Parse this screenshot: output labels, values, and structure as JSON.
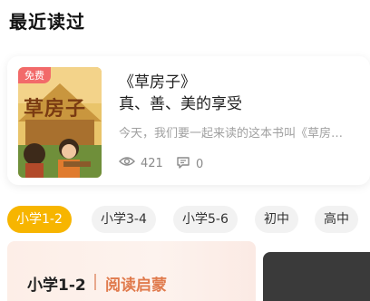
{
  "section": {
    "title": "最近读过"
  },
  "recent_book": {
    "badge": "免费",
    "cover_title": "草房子",
    "title": "《草房子》",
    "subtitle": "真、善、美的享受",
    "description": "今天，我们要一起来读的这本书叫《草房子》",
    "views": "421",
    "comments": "0",
    "icons": {
      "views": "eye-icon",
      "comments": "comment-icon"
    }
  },
  "grade_tabs": [
    {
      "label": "小学1-2",
      "active": true
    },
    {
      "label": "小学3-4",
      "active": false
    },
    {
      "label": "小学5-6",
      "active": false
    },
    {
      "label": "初中",
      "active": false
    },
    {
      "label": "高中",
      "active": false
    }
  ],
  "banner": {
    "level": "小学1-2",
    "subtitle": "阅读启蒙"
  },
  "colors": {
    "accent": "#f7b500",
    "badge": "#f26a6a",
    "banner_text": "#e07a4c"
  }
}
